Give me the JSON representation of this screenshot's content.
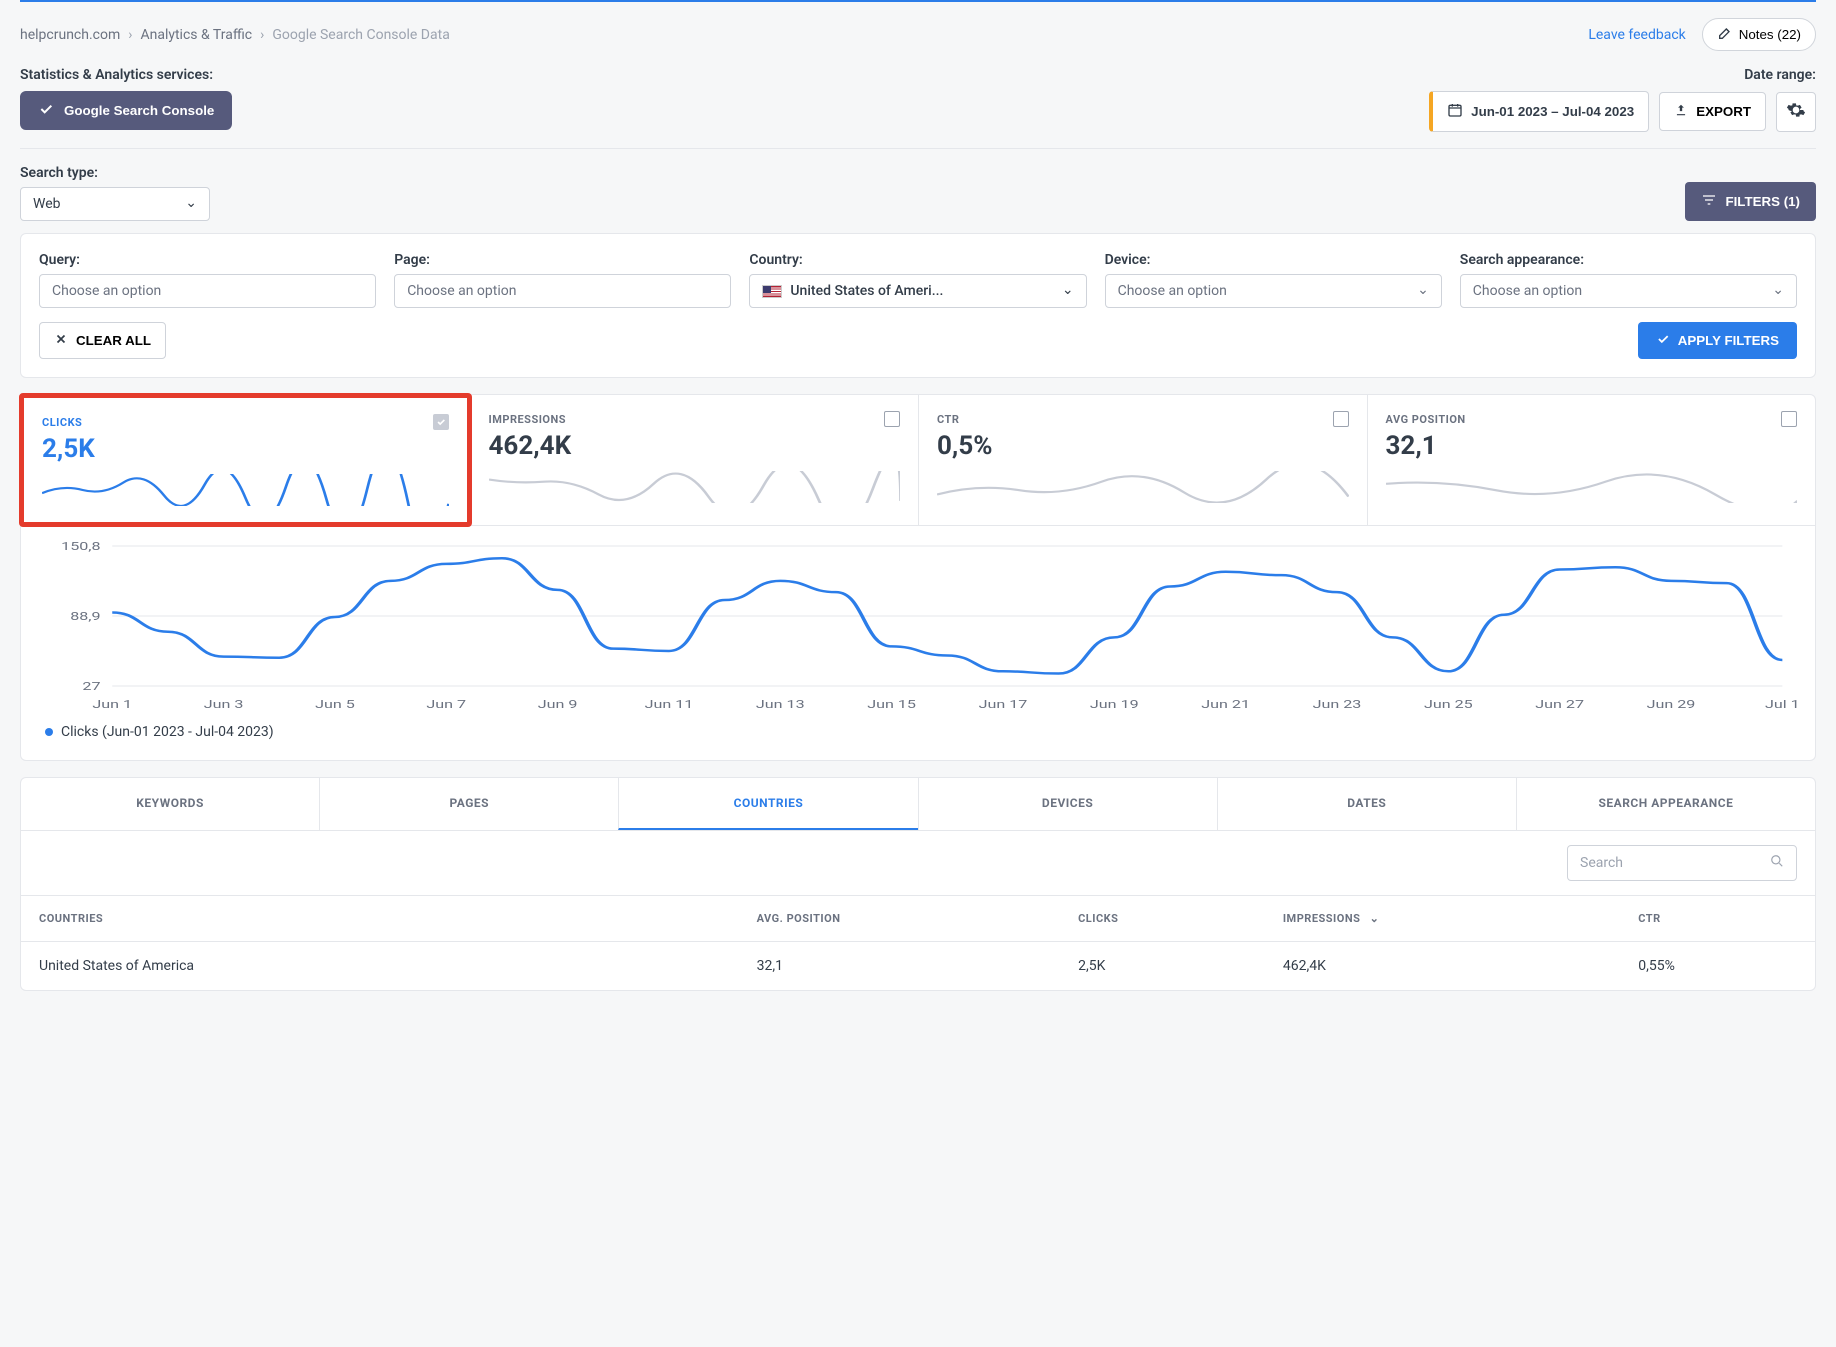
{
  "breadcrumbs": {
    "site": "helpcrunch.com",
    "section": "Analytics & Traffic",
    "current": "Google Search Console Data"
  },
  "top": {
    "leave_feedback": "Leave feedback",
    "notes_label": "Notes (22)"
  },
  "services": {
    "label": "Statistics & Analytics services:",
    "gsc": "Google Search Console"
  },
  "date_range": {
    "label": "Date range:",
    "value": "Jun-01 2023 – Jul-04 2023",
    "export": "EXPORT"
  },
  "search_type": {
    "label": "Search type:",
    "value": "Web",
    "filters_btn": "FILTERS (1)"
  },
  "filters": {
    "query": {
      "label": "Query:",
      "placeholder": "Choose an option"
    },
    "page": {
      "label": "Page:",
      "placeholder": "Choose an option"
    },
    "country": {
      "label": "Country:",
      "value": "United States of Ameri..."
    },
    "device": {
      "label": "Device:",
      "placeholder": "Choose an option"
    },
    "appearance": {
      "label": "Search appearance:",
      "placeholder": "Choose an option"
    },
    "clear": "CLEAR ALL",
    "apply": "APPLY FILTERS"
  },
  "metrics": {
    "clicks": {
      "title": "CLICKS",
      "value": "2,5K"
    },
    "impressions": {
      "title": "IMPRESSIONS",
      "value": "462,4K"
    },
    "ctr": {
      "title": "CTR",
      "value": "0,5%"
    },
    "pos": {
      "title": "AVG POSITION",
      "value": "32,1"
    }
  },
  "legend": "Clicks (Jun-01 2023 - Jul-04 2023)",
  "tabs": {
    "keywords": "KEYWORDS",
    "pages": "PAGES",
    "countries": "COUNTRIES",
    "devices": "DEVICES",
    "dates": "DATES",
    "appearance": "SEARCH APPEARANCE"
  },
  "table": {
    "search_placeholder": "Search",
    "headers": {
      "countries": "COUNTRIES",
      "avgpos": "AVG. POSITION",
      "clicks": "CLICKS",
      "impressions": "IMPRESSIONS",
      "ctr": "CTR"
    },
    "rows": [
      {
        "country": "United States of America",
        "avgpos": "32,1",
        "clicks": "2,5K",
        "impressions": "462,4K",
        "ctr": "0,55%"
      }
    ]
  },
  "chart_data": {
    "type": "line",
    "title": "Clicks (Jun-01 2023 - Jul-04 2023)",
    "xlabel": "",
    "ylabel": "",
    "ylim": [
      27,
      150.8
    ],
    "y_ticks": [
      27,
      88.9,
      150.8
    ],
    "x_ticks": [
      "Jun 1",
      "Jun 3",
      "Jun 5",
      "Jun 7",
      "Jun 9",
      "Jun 11",
      "Jun 13",
      "Jun 15",
      "Jun 17",
      "Jun 19",
      "Jun 21",
      "Jun 23",
      "Jun 25",
      "Jun 27",
      "Jun 29",
      "Jul 1"
    ],
    "series": [
      {
        "name": "Clicks",
        "color": "#2b7de9",
        "x": [
          "Jun 1",
          "Jun 2",
          "Jun 3",
          "Jun 4",
          "Jun 5",
          "Jun 6",
          "Jun 7",
          "Jun 8",
          "Jun 9",
          "Jun 10",
          "Jun 11",
          "Jun 12",
          "Jun 13",
          "Jun 14",
          "Jun 15",
          "Jun 16",
          "Jun 17",
          "Jun 18",
          "Jun 19",
          "Jun 20",
          "Jun 21",
          "Jun 22",
          "Jun 23",
          "Jun 24",
          "Jun 25",
          "Jun 26",
          "Jun 27",
          "Jun 28",
          "Jun 29",
          "Jun 30",
          "Jul 1"
        ],
        "values": [
          92,
          75,
          53,
          52,
          88,
          120,
          135,
          140,
          112,
          60,
          58,
          103,
          120,
          110,
          62,
          54,
          40,
          38,
          70,
          115,
          128,
          125,
          110,
          70,
          40,
          90,
          130,
          132,
          120,
          118,
          50
        ]
      }
    ]
  }
}
